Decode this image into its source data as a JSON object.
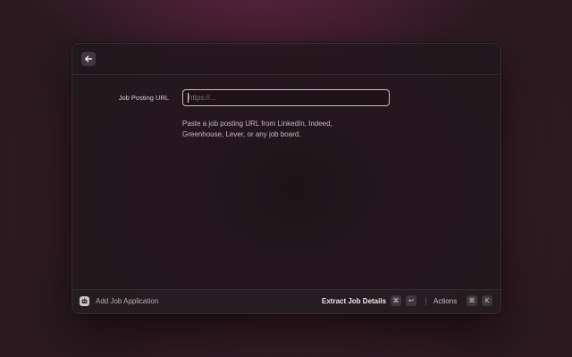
{
  "header": {
    "back_icon": "arrow-left-icon"
  },
  "form": {
    "url_label": "Job Posting URL",
    "url_value": "",
    "url_placeholder": "https://...",
    "help_line_1": "Paste a job posting URL from LinkedIn, Indeed,",
    "help_line_2": "Greenhouse, Lever, or any job board."
  },
  "footer": {
    "app_icon": "robot-icon",
    "title": "Add Job Application",
    "primary_action": "Extract Job Details",
    "primary_shortcut": [
      "⌘",
      "↩"
    ],
    "actions_label": "Actions",
    "actions_shortcut": [
      "⌘",
      "K"
    ]
  }
}
